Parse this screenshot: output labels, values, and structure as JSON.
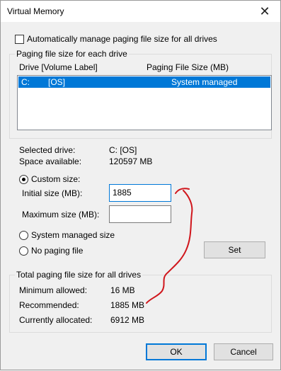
{
  "window": {
    "title": "Virtual Memory",
    "close_glyph": "✕"
  },
  "auto_manage": {
    "label": "Automatically manage paging file size for all drives",
    "checked": false
  },
  "per_drive": {
    "caption": "Paging file size for each drive",
    "col_drive": "Drive  [Volume Label]",
    "col_size": "Paging File Size (MB)",
    "rows": [
      {
        "drive": "C:",
        "label": "[OS]",
        "size": "System managed",
        "selected": true
      }
    ]
  },
  "selected_drive": {
    "label": "Selected drive:",
    "value": "C:  [OS]",
    "space_label": "Space available:",
    "space_value": "120597 MB"
  },
  "custom_size": {
    "label": "Custom size:",
    "selected": true,
    "initial_label": "Initial size (MB):",
    "initial_value": "1885",
    "max_label": "Maximum size (MB):",
    "max_value": ""
  },
  "system_managed": {
    "label": "System managed size",
    "selected": false
  },
  "no_paging": {
    "label": "No paging file",
    "selected": false
  },
  "set_button": {
    "label": "Set"
  },
  "totals": {
    "caption": "Total paging file size for all drives",
    "min_label": "Minimum allowed:",
    "min_value": "16 MB",
    "rec_label": "Recommended:",
    "rec_value": "1885 MB",
    "cur_label": "Currently allocated:",
    "cur_value": "6912 MB"
  },
  "ok_button": {
    "label": "OK"
  },
  "cancel_button": {
    "label": "Cancel"
  },
  "colors": {
    "selection": "#0078d7",
    "annotation": "#d0161c"
  }
}
